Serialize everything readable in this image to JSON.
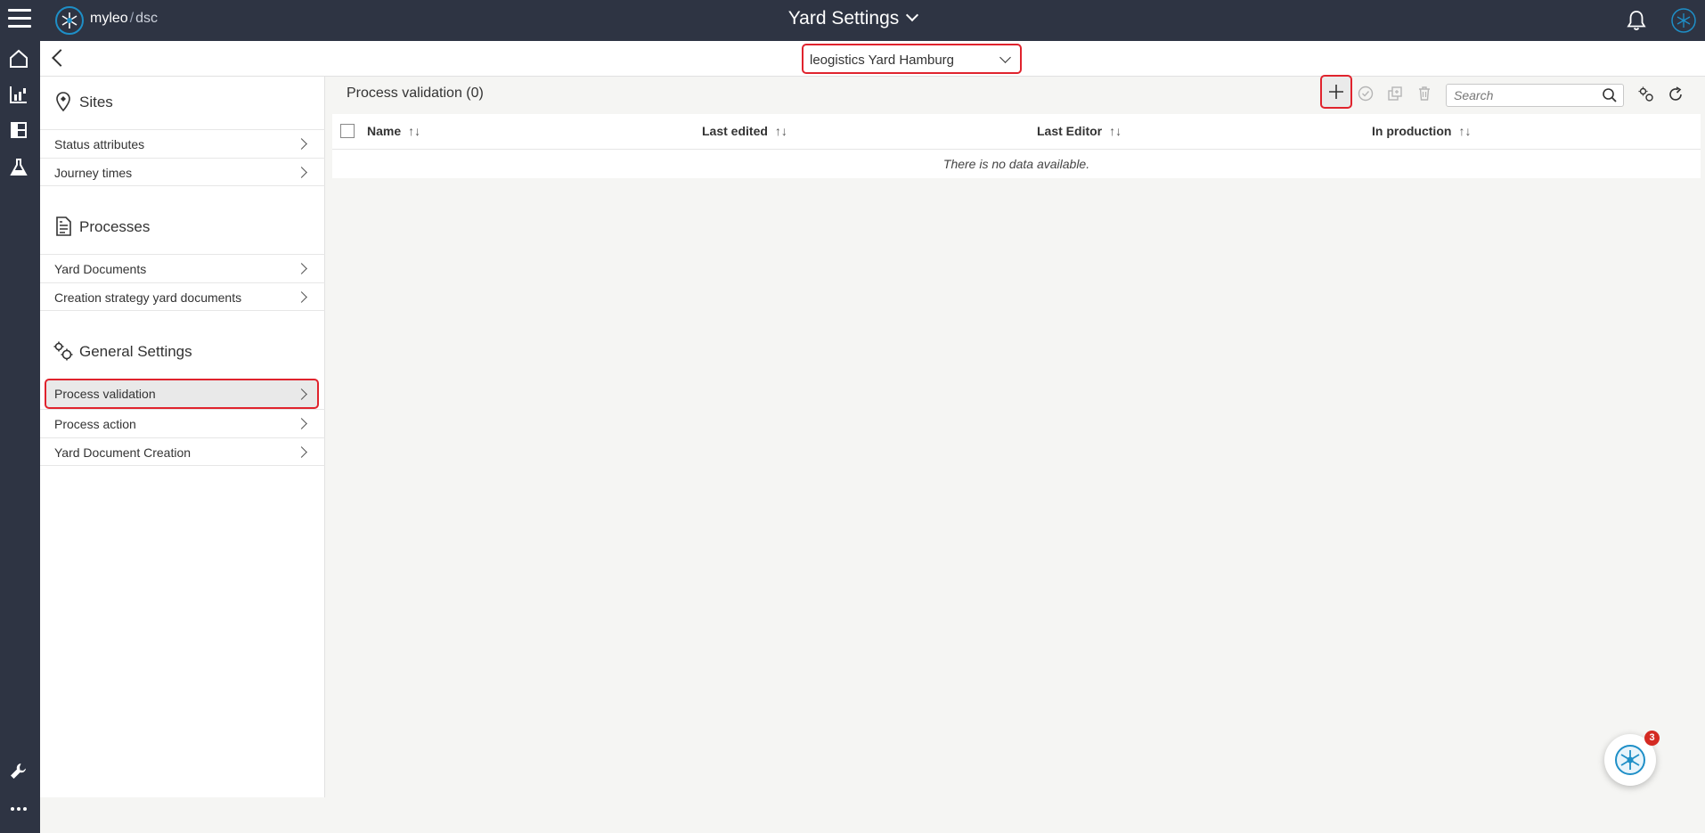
{
  "header": {
    "brand_name": "myleo",
    "brand_separator": "/",
    "brand_product": "dsc",
    "title": "Yard Settings"
  },
  "subheader": {
    "site": "leogistics Yard Hamburg"
  },
  "sidebar": {
    "sections": [
      {
        "title": "Sites",
        "icon": "map-pin-icon",
        "items": [
          "Status attributes",
          "Journey times"
        ]
      },
      {
        "title": "Processes",
        "icon": "document-icon",
        "items": [
          "Yard Documents",
          "Creation strategy yard documents"
        ]
      },
      {
        "title": "General Settings",
        "icon": "gears-icon",
        "items": [
          "Process validation",
          "Process action",
          "Yard Document Creation"
        ]
      }
    ],
    "active_item": "Process validation"
  },
  "main": {
    "title": "Process validation (0)",
    "search_placeholder": "Search",
    "columns": [
      "Name",
      "Last edited",
      "Last Editor",
      "In production"
    ],
    "empty_message": "There is no data available.",
    "sort_glyph": "↑↓"
  },
  "assistant": {
    "badge_count": "3"
  },
  "colors": {
    "header_bg": "#2e3443",
    "highlight": "#e0232d",
    "accent": "#1e8fc7",
    "badge": "#d42a22"
  }
}
